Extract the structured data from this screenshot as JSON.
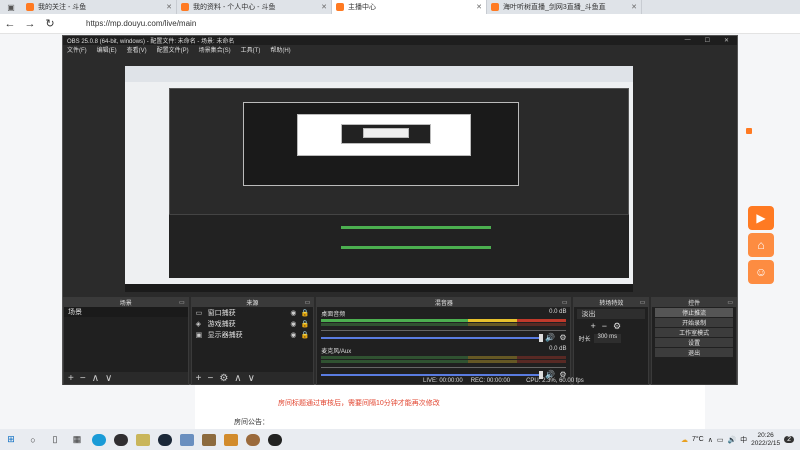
{
  "browser": {
    "tabs": [
      {
        "label": "我的关注 - 斗鱼",
        "color": "#ff7a22"
      },
      {
        "label": "我的资料 - 个人中心 - 斗鱼",
        "color": "#ff7a22"
      },
      {
        "label": "主播中心",
        "color": "#ff7a22",
        "active": true
      },
      {
        "label": "海叶听树直播_剑网3直播_斗鱼直",
        "color": "#ff7a22"
      }
    ],
    "url": "https://mp.douyu.com/live/main",
    "nav": {
      "back": "←",
      "forward": "→",
      "refresh": "↻"
    }
  },
  "page": {
    "notice": "房间标题通过审核后，需要间隔10分钟才能再次修改",
    "room_announcement_label": "房间公告：",
    "accent": "#ff7a22"
  },
  "obs": {
    "title": "OBS 25.0.8 (64-bit, windows) - 配置文件: 未命名 - 场景: 未命名",
    "menu": [
      "文件(F)",
      "编辑(E)",
      "查看(V)",
      "配置文件(P)",
      "场景集合(S)",
      "工具(T)",
      "帮助(H)"
    ],
    "window_controls": {
      "minimize": "—",
      "maximize": "☐",
      "close": "✕"
    },
    "docks": {
      "scenes": {
        "title": "场景",
        "items": [
          "场景"
        ]
      },
      "sources": {
        "title": "来源",
        "items": [
          {
            "name": "窗口捕获",
            "icon": "window-icon"
          },
          {
            "name": "游戏捕获",
            "icon": "gamepad-icon"
          },
          {
            "name": "显示器捕获",
            "icon": "monitor-icon"
          }
        ]
      },
      "mixer": {
        "title": "混音器",
        "tracks": [
          {
            "name": "桌面音频",
            "db": "0.0 dB"
          },
          {
            "name": "麦克风/Aux",
            "db": "0.0 dB"
          }
        ]
      },
      "transitions": {
        "title": "转场特效",
        "type": "淡出",
        "duration_label": "时长",
        "duration_value": "300 ms"
      },
      "controls": {
        "title": "控件",
        "buttons": [
          "停止推流",
          "开始录制",
          "工作室模式",
          "设置",
          "退出"
        ]
      }
    },
    "status": {
      "live": "LIVE: 00:00:00",
      "rec": "REC: 00:00:00",
      "cpu": "CPU: 2.3%, 60.00 fps"
    }
  },
  "taskbar": {
    "weather": "7°C",
    "lang": "中",
    "time": "20:26",
    "date": "2022/2/15",
    "notification": "2"
  }
}
